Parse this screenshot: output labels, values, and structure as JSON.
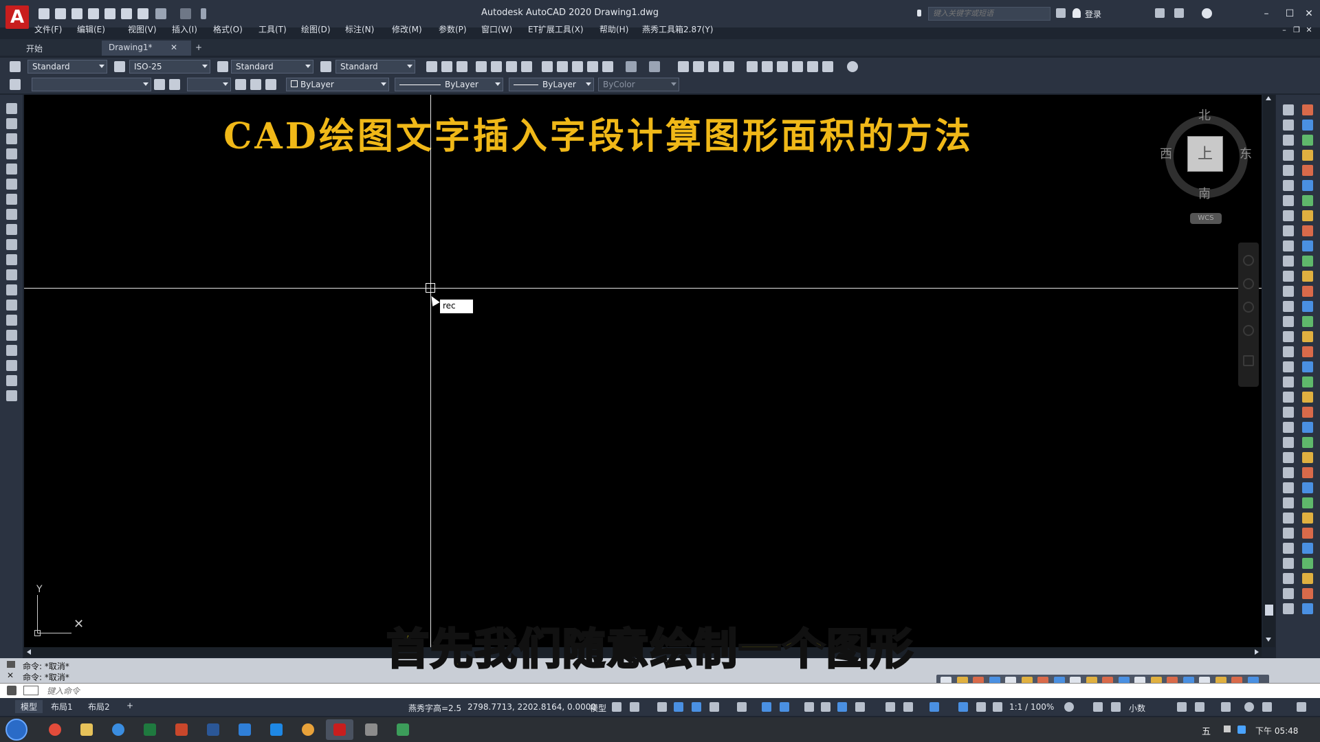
{
  "app": {
    "logo_letter": "A",
    "title": "Autodesk AutoCAD 2020    Drawing1.dwg",
    "search_placeholder": "键入关键字或短语",
    "login": "登录"
  },
  "menu": [
    "文件(F)",
    "编辑(E)",
    "视图(V)",
    "插入(I)",
    "格式(O)",
    "工具(T)",
    "绘图(D)",
    "标注(N)",
    "修改(M)",
    "参数(P)",
    "窗口(W)",
    "ET扩展工具(X)",
    "帮助(H)",
    "燕秀工具箱2.87(Y)"
  ],
  "tabs": {
    "start": "开始",
    "drawing": "Drawing1*",
    "close": "✕",
    "add": "+"
  },
  "toolbar1": {
    "text_style": "Standard",
    "dim_style": "ISO-25",
    "table_style": "Standard",
    "mleader_style": "Standard"
  },
  "toolbar2": {
    "layer": "",
    "color": "ByLayer",
    "linetype": "ByLayer",
    "lineweight": "ByLayer",
    "plotstyle": "ByColor"
  },
  "canvas": {
    "title": "CAD绘图文字插入字段计算图形面积的方法",
    "cmd_tooltip": "rec",
    "ucs_y": "Y",
    "ucs_x": "✕"
  },
  "viewcube": {
    "north": "北",
    "south": "南",
    "east": "东",
    "west": "西",
    "face": "上",
    "wcs": "WCS"
  },
  "subtitle": "首先我们随意绘制一个图形",
  "command": {
    "history": [
      "命令: *取消*",
      "命令: *取消*"
    ],
    "input_placeholder": "键入命令"
  },
  "layout_tabs": [
    "模型",
    "布局1",
    "布局2",
    "+"
  ],
  "status": {
    "text_height": "燕秀字高=2.5",
    "coords": "2798.7713, 2202.8164, 0.0000",
    "space": "模型",
    "scale": "1:1 / 100%",
    "units": "小数"
  },
  "taskbar": {
    "clock": "下午 05:48",
    "ime": "五"
  },
  "colors": {
    "title_accent": "#f0b818",
    "subtitle": "#f5e800",
    "canvas": "#000000",
    "ui_dark": "#2b3341"
  }
}
